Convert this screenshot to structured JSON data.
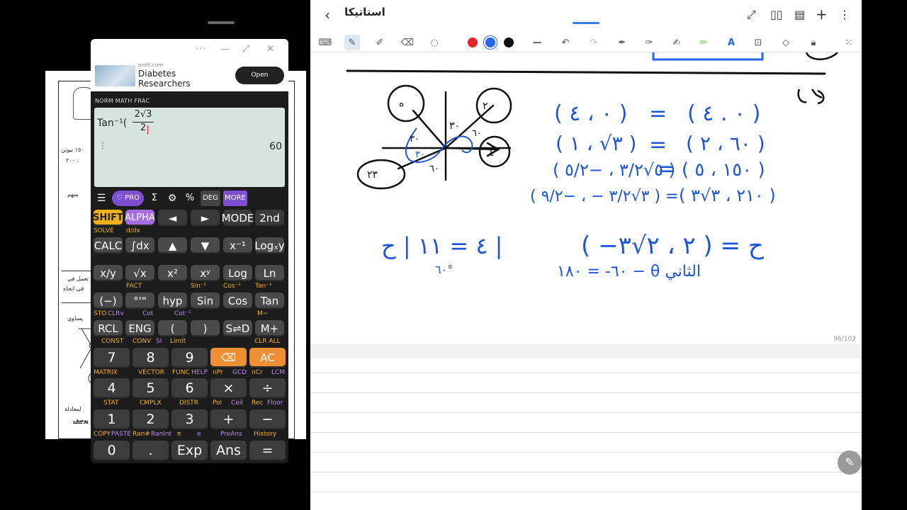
{
  "calculator": {
    "ad": {
      "source": "profil.com",
      "title_line1": "Diabetes",
      "title_line2": "Researchers",
      "cta": "Open"
    },
    "mode_line": "NORM MATH FRAC",
    "expression_func": "Tan⁻¹(",
    "expression_num": "2√3",
    "expression_den": "2",
    "result": "60",
    "toolbar": [
      "PRO",
      "DEG",
      "MORE"
    ],
    "top_keys": [
      "SHIFT",
      "ALPHA",
      "◄",
      "►",
      "MODE",
      "2nd"
    ],
    "row1": [
      "CALC",
      "∫dx",
      "▲",
      "▼",
      "x⁻¹",
      "Logₓy"
    ],
    "row2": [
      "x/y",
      "√x",
      "x²",
      "xʸ",
      "Log",
      "Ln"
    ],
    "row3": [
      "(−)",
      "°'\"",
      "hyp",
      "Sin",
      "Cos",
      "Tan"
    ],
    "row4": [
      "RCL",
      "ENG",
      "(",
      ")",
      "S⇌D",
      "M+"
    ],
    "num_row1": [
      "7",
      "8",
      "9",
      "⌫",
      "AC"
    ],
    "num_row2": [
      "4",
      "5",
      "6",
      "×",
      "÷"
    ],
    "num_row3": [
      "1",
      "2",
      "3",
      "+",
      "−"
    ],
    "num_row4": [
      "0",
      ".",
      "Exp",
      "Ans",
      "="
    ],
    "labels": {
      "solve": "SOLVE",
      "ddx": "d/dx",
      "fact": "FACT",
      "sin_inv": "Sin⁻¹",
      "cos_inv": "Cos⁻¹",
      "tan_inv": "Tan⁻¹",
      "sto": "STO",
      "clrv": "CLRv",
      "cot": "Cot",
      "cot_inv": "Cot⁻¹",
      "mminus": "M−",
      "const": "CONST",
      "conv": "CONV",
      "si": "SI",
      "limit": "Limit",
      "clr_all": "CLR ALL",
      "matrix": "MATRIX",
      "vector": "VECTOR",
      "func": "FUNC",
      "help": "HELP",
      "npr": "nPr",
      "gcd": "GCD",
      "ncr": "nCr",
      "lcm": "LCM",
      "stat": "STAT",
      "cmplx": "CMPLX",
      "distr": "DISTR",
      "pol": "Pol",
      "ceil": "Ceil",
      "rec": "Rec",
      "floor": "Floor",
      "copy": "COPY",
      "paste": "PASTE",
      "ran": "Ran#",
      "ranint": "RanInt",
      "pi": "π",
      "e": "e",
      "preans": "PreAns",
      "history": "History"
    }
  },
  "notes": {
    "title": "استاتيكا",
    "page_number": "96/102",
    "colors": {
      "red": "#e5252c",
      "blue": "#2563eb",
      "black": "#111111",
      "ink": "#1d55d6"
    }
  },
  "paper": {
    "lines": [
      "١٥٠ نيوتن",
      "٢٠٠ ،",
      "منهم",
      "تعمل في",
      "في اتجاه",
      "يساوي",
      "لمعادلة",
      "يوصف"
    ]
  }
}
